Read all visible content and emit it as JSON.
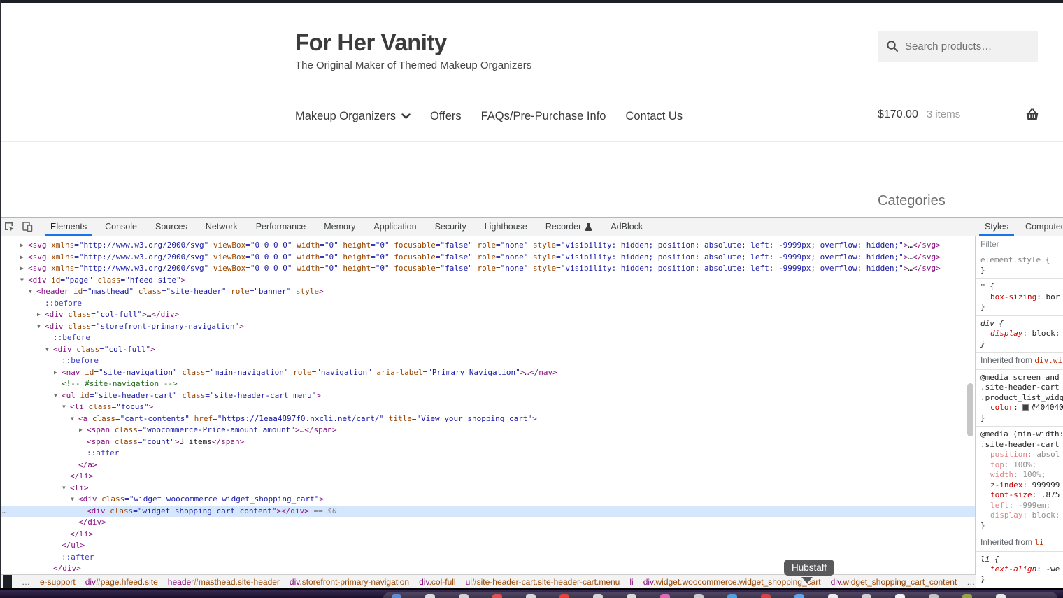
{
  "site": {
    "title": "For Her Vanity",
    "tagline": "The Original Maker of Themed Makeup Organizers",
    "search": {
      "placeholder": "Search products…",
      "icon": "magnifier-icon"
    },
    "nav": [
      {
        "label": "Makeup Organizers",
        "has_dropdown": true
      },
      {
        "label": "Offers",
        "has_dropdown": false
      },
      {
        "label": "FAQs/Pre-Purchase Info",
        "has_dropdown": false
      },
      {
        "label": "Contact Us",
        "has_dropdown": false
      }
    ],
    "cart": {
      "total": "$170.00",
      "count": "3 items",
      "icon": "basket-icon"
    },
    "categories_heading": "Categories"
  },
  "devtools": {
    "tabs": [
      "Elements",
      "Console",
      "Sources",
      "Network",
      "Performance",
      "Memory",
      "Application",
      "Security",
      "Lighthouse",
      "Recorder",
      "AdBlock"
    ],
    "selected_tab": "Elements",
    "code_lines": [
      {
        "i": 0,
        "s": [
          [
            "ar",
            "▶"
          ],
          [
            "tg",
            "<svg"
          ],
          [
            "at",
            " xmlns"
          ],
          [
            "vl",
            "=\"http://www.w3.org/2000/svg\""
          ],
          [
            "at",
            " viewBox"
          ],
          [
            "vl",
            "=\"0 0 0 0\""
          ],
          [
            "at",
            " width"
          ],
          [
            "vl",
            "=\"0\""
          ],
          [
            "at",
            " height"
          ],
          [
            "vl",
            "=\"0\""
          ],
          [
            "at",
            " focusable"
          ],
          [
            "vl",
            "=\"false\""
          ],
          [
            "at",
            " role"
          ],
          [
            "vl",
            "=\"none\""
          ],
          [
            "at",
            " style"
          ],
          [
            "vl",
            "=\"visibility: hidden; position: absolute; left: -9999px; overflow: hidden;\""
          ],
          [
            "tg",
            ">"
          ],
          [
            "el",
            "…"
          ],
          [
            "tg",
            "</svg>"
          ]
        ]
      },
      {
        "i": 0,
        "s": [
          [
            "ar",
            "▶"
          ],
          [
            "tg",
            "<svg"
          ],
          [
            "at",
            " xmlns"
          ],
          [
            "vl",
            "=\"http://www.w3.org/2000/svg\""
          ],
          [
            "at",
            " viewBox"
          ],
          [
            "vl",
            "=\"0 0 0 0\""
          ],
          [
            "at",
            " width"
          ],
          [
            "vl",
            "=\"0\""
          ],
          [
            "at",
            " height"
          ],
          [
            "vl",
            "=\"0\""
          ],
          [
            "at",
            " focusable"
          ],
          [
            "vl",
            "=\"false\""
          ],
          [
            "at",
            " role"
          ],
          [
            "vl",
            "=\"none\""
          ],
          [
            "at",
            " style"
          ],
          [
            "vl",
            "=\"visibility: hidden; position: absolute; left: -9999px; overflow: hidden;\""
          ],
          [
            "tg",
            ">"
          ],
          [
            "el",
            "…"
          ],
          [
            "tg",
            "</svg>"
          ]
        ]
      },
      {
        "i": 0,
        "s": [
          [
            "ar",
            "▶"
          ],
          [
            "tg",
            "<svg"
          ],
          [
            "at",
            " xmlns"
          ],
          [
            "vl",
            "=\"http://www.w3.org/2000/svg\""
          ],
          [
            "at",
            " viewBox"
          ],
          [
            "vl",
            "=\"0 0 0 0\""
          ],
          [
            "at",
            " width"
          ],
          [
            "vl",
            "=\"0\""
          ],
          [
            "at",
            " height"
          ],
          [
            "vl",
            "=\"0\""
          ],
          [
            "at",
            " focusable"
          ],
          [
            "vl",
            "=\"false\""
          ],
          [
            "at",
            " role"
          ],
          [
            "vl",
            "=\"none\""
          ],
          [
            "at",
            " style"
          ],
          [
            "vl",
            "=\"visibility: hidden; position: absolute; left: -9999px; overflow: hidden;\""
          ],
          [
            "tg",
            ">"
          ],
          [
            "el",
            "…"
          ],
          [
            "tg",
            "</svg>"
          ]
        ]
      },
      {
        "i": 0,
        "s": [
          [
            "ar",
            "▼"
          ],
          [
            "tg",
            "<div"
          ],
          [
            "at",
            " id"
          ],
          [
            "vl",
            "=\"page\""
          ],
          [
            "at",
            " class"
          ],
          [
            "vl",
            "=\"hfeed site\""
          ],
          [
            "tg",
            ">"
          ]
        ]
      },
      {
        "i": 1,
        "s": [
          [
            "ar",
            "▼"
          ],
          [
            "tg",
            "<header"
          ],
          [
            "at",
            " id"
          ],
          [
            "vl",
            "=\"masthead\""
          ],
          [
            "at",
            " class"
          ],
          [
            "vl",
            "=\"site-header\""
          ],
          [
            "at",
            " role"
          ],
          [
            "vl",
            "=\"banner\""
          ],
          [
            "at",
            " style"
          ],
          [
            "tg",
            ">"
          ]
        ]
      },
      {
        "i": 2,
        "s": [
          [
            "ps",
            "::before"
          ]
        ]
      },
      {
        "i": 2,
        "s": [
          [
            "ar",
            "▶"
          ],
          [
            "tg",
            "<div"
          ],
          [
            "at",
            " class"
          ],
          [
            "vl",
            "=\"col-full\""
          ],
          [
            "tg",
            ">"
          ],
          [
            "el",
            "…"
          ],
          [
            "tg",
            "</div>"
          ]
        ]
      },
      {
        "i": 2,
        "s": [
          [
            "ar",
            "▼"
          ],
          [
            "tg",
            "<div"
          ],
          [
            "at",
            " class"
          ],
          [
            "vl",
            "=\"storefront-primary-navigation\""
          ],
          [
            "tg",
            ">"
          ]
        ]
      },
      {
        "i": 3,
        "s": [
          [
            "ps",
            "::before"
          ]
        ]
      },
      {
        "i": 3,
        "s": [
          [
            "ar",
            "▼"
          ],
          [
            "tg",
            "<div"
          ],
          [
            "at",
            " class"
          ],
          [
            "vl",
            "=\"col-full\""
          ],
          [
            "tg",
            ">"
          ]
        ]
      },
      {
        "i": 4,
        "s": [
          [
            "ps",
            "::before"
          ]
        ]
      },
      {
        "i": 4,
        "s": [
          [
            "ar",
            "▶"
          ],
          [
            "tg",
            "<nav"
          ],
          [
            "at",
            " id"
          ],
          [
            "vl",
            "=\"site-navigation\""
          ],
          [
            "at",
            " class"
          ],
          [
            "vl",
            "=\"main-navigation\""
          ],
          [
            "at",
            " role"
          ],
          [
            "vl",
            "=\"navigation\""
          ],
          [
            "at",
            " aria-label"
          ],
          [
            "vl",
            "=\"Primary Navigation\""
          ],
          [
            "tg",
            ">"
          ],
          [
            "el",
            "…"
          ],
          [
            "tg",
            "</nav>"
          ]
        ]
      },
      {
        "i": 4,
        "s": [
          [
            "cm",
            "<!-- #site-navigation -->"
          ]
        ]
      },
      {
        "i": 4,
        "s": [
          [
            "ar",
            "▼"
          ],
          [
            "tg",
            "<ul"
          ],
          [
            "at",
            " id"
          ],
          [
            "vl",
            "=\"site-header-cart\""
          ],
          [
            "at",
            " class"
          ],
          [
            "vl",
            "=\"site-header-cart menu\""
          ],
          [
            "tg",
            ">"
          ]
        ]
      },
      {
        "i": 5,
        "s": [
          [
            "ar",
            "▼"
          ],
          [
            "tg",
            "<li"
          ],
          [
            "at",
            " class"
          ],
          [
            "vl",
            "=\"focus\""
          ],
          [
            "tg",
            ">"
          ]
        ]
      },
      {
        "i": 6,
        "s": [
          [
            "ar",
            "▼"
          ],
          [
            "tg",
            "<a"
          ],
          [
            "at",
            " class"
          ],
          [
            "vl",
            "=\"cart-contents\""
          ],
          [
            "at",
            " href"
          ],
          [
            "vl",
            "=\""
          ],
          [
            "lk",
            "https://1eaa4897f0.nxcli.net/cart/"
          ],
          [
            "vl",
            "\""
          ],
          [
            "at",
            " title"
          ],
          [
            "vl",
            "=\"View your shopping cart\""
          ],
          [
            "tg",
            ">"
          ]
        ]
      },
      {
        "i": 7,
        "s": [
          [
            "ar",
            "▶"
          ],
          [
            "tg",
            "<span"
          ],
          [
            "at",
            " class"
          ],
          [
            "vl",
            "=\"woocommerce-Price-amount amount\""
          ],
          [
            "tg",
            ">"
          ],
          [
            "el",
            "…"
          ],
          [
            "tg",
            "</span>"
          ]
        ]
      },
      {
        "i": 7,
        "s": [
          [
            "tg",
            "<span"
          ],
          [
            "at",
            " class"
          ],
          [
            "vl",
            "=\"count\""
          ],
          [
            "tg",
            ">"
          ],
          [
            "bk",
            "3 items"
          ],
          [
            "tg",
            "</span>"
          ]
        ]
      },
      {
        "i": 7,
        "s": [
          [
            "ps",
            "::after"
          ]
        ]
      },
      {
        "i": 6,
        "s": [
          [
            "tg",
            "</a>"
          ]
        ]
      },
      {
        "i": 5,
        "s": [
          [
            "tg",
            "</li>"
          ]
        ]
      },
      {
        "i": 5,
        "s": [
          [
            "ar",
            "▼"
          ],
          [
            "tg",
            "<li>"
          ]
        ]
      },
      {
        "i": 6,
        "s": [
          [
            "ar",
            "▼"
          ],
          [
            "tg",
            "<div"
          ],
          [
            "at",
            " class"
          ],
          [
            "vl",
            "=\"widget woocommerce widget_shopping_cart\""
          ],
          [
            "tg",
            ">"
          ]
        ]
      },
      {
        "i": 7,
        "sel": true,
        "s": [
          [
            "tg",
            "<div"
          ],
          [
            "at",
            " class"
          ],
          [
            "vl",
            "=\"widget_shopping_cart_content\""
          ],
          [
            "tg",
            "></div>"
          ],
          [
            "gy",
            " == $0"
          ]
        ]
      },
      {
        "i": 6,
        "s": [
          [
            "tg",
            "</div>"
          ]
        ]
      },
      {
        "i": 5,
        "s": [
          [
            "tg",
            "</li>"
          ]
        ]
      },
      {
        "i": 4,
        "s": [
          [
            "tg",
            "</ul>"
          ]
        ]
      },
      {
        "i": 4,
        "s": [
          [
            "ps",
            "::after"
          ]
        ]
      },
      {
        "i": 3,
        "s": [
          [
            "tg",
            "</div>"
          ]
        ]
      }
    ],
    "styles_pane": {
      "tabs": [
        "Styles",
        "Computed"
      ],
      "active_tab": "Styles",
      "filter_placeholder": "Filter",
      "sections": [
        {
          "kind": "rule",
          "sel": [
            "element.style {"
          ],
          "selStyle": "gray",
          "props": [],
          "close": "}"
        },
        {
          "kind": "rule",
          "sel": [
            "* {"
          ],
          "props": [
            {
              "n": "box-sizing",
              "v": "bor"
            }
          ],
          "close": "}"
        },
        {
          "kind": "rule",
          "ua": true,
          "sel": [
            "div {"
          ],
          "props": [
            {
              "n": "display",
              "v": "block;"
            }
          ],
          "close": "}"
        },
        {
          "kind": "head",
          "label": "Inherited from ",
          "link": "div.wi"
        },
        {
          "kind": "rule",
          "sel": [
            "@media screen and",
            ".site-header-cart",
            ".product_list_widg"
          ],
          "props": [
            {
              "n": "color",
              "v": "#404040",
              "swatch": "#404040"
            }
          ],
          "close": "}"
        },
        {
          "kind": "rule",
          "sel": [
            "@media (min-width:",
            ".site-header-cart"
          ],
          "props": [
            {
              "n": "position",
              "v": "absol",
              "dim": true
            },
            {
              "n": "top",
              "v": "100%;",
              "dim": true
            },
            {
              "n": "width",
              "v": "100%;",
              "dim": true
            },
            {
              "n": "z-index",
              "v": "999999"
            },
            {
              "n": "font-size",
              "v": ".875"
            },
            {
              "n": "left",
              "v": "-999em;",
              "dim": true
            },
            {
              "n": "display",
              "v": "block;",
              "dim": true
            }
          ],
          "close": "}"
        },
        {
          "kind": "head",
          "label": "Inherited from ",
          "link": "li"
        },
        {
          "kind": "rule",
          "ua": true,
          "sel": [
            "li {"
          ],
          "props": [
            {
              "n": "text-align",
              "v": "-we"
            }
          ],
          "close": "}"
        }
      ]
    },
    "breadcrumbs": [
      {
        "t": "",
        "r": "…",
        "muted": true
      },
      {
        "t": "",
        "r": "e-support"
      },
      {
        "t": "div",
        "r": "#page.hfeed.site"
      },
      {
        "t": "header",
        "r": "#masthead.site-header"
      },
      {
        "t": "div",
        "r": ".storefront-primary-navigation"
      },
      {
        "t": "div",
        "r": ".col-full"
      },
      {
        "t": "ul",
        "r": "#site-header-cart.site-header-cart.menu"
      },
      {
        "t": "li",
        "r": ""
      },
      {
        "t": "div",
        "r": ".widget.woocommerce.widget_shopping_cart"
      },
      {
        "t": "div",
        "r": ".widget_shopping_cart_content",
        "current": true
      },
      {
        "t": "",
        "r": "…",
        "muted": true
      }
    ]
  },
  "tooltip": {
    "label": "Hubstaff"
  },
  "dock": {
    "icon_colors": [
      "#5b8dd9",
      "#dcdcdc",
      "#d3d3d3",
      "#e0524f",
      "#d8d8d8",
      "#e8413c",
      "#d6d6d6",
      "#dadada",
      "#e06ab8",
      "#cccccc",
      "#4f9ee8",
      "#d64541",
      "#5aa7f0",
      "#ececec",
      "#d0d0d0",
      "#f2f2f2",
      "#c4c4c4",
      "#97a04a",
      "#e8e8e8"
    ]
  }
}
